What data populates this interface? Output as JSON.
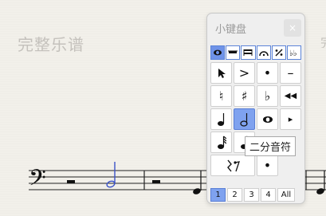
{
  "score": {
    "title": "完整乐谱",
    "title_cut_right": "完"
  },
  "palette": {
    "title": "小键盘",
    "close_label": "×",
    "tabs": [
      {
        "name": "tab-notes",
        "icon": "whole-note-icon",
        "active": true
      },
      {
        "name": "tab-rests",
        "icon": "rest-icon",
        "active": false
      },
      {
        "name": "tab-beams",
        "icon": "beam-icon",
        "active": false
      },
      {
        "name": "tab-articulations",
        "icon": "fermata-icon",
        "active": false
      },
      {
        "name": "tab-tuplets",
        "icon": "tuplet-icon",
        "active": false
      },
      {
        "name": "tab-accidentals",
        "icon": "double-flat-icon",
        "active": false
      }
    ],
    "rows": [
      [
        {
          "label": "",
          "icon": "pointer-icon"
        },
        {
          "label": ">",
          "icon": "accent-icon"
        },
        {
          "label": "•",
          "icon": "staccato-icon"
        },
        {
          "label": "–",
          "icon": "tenuto-icon"
        }
      ],
      [
        {
          "label": "♮",
          "icon": "natural-icon"
        },
        {
          "label": "♯",
          "icon": "sharp-icon"
        },
        {
          "label": "♭",
          "icon": "flat-icon"
        },
        {
          "label": "◀◀",
          "icon": "rewind-icon"
        }
      ],
      [
        {
          "label": "♩",
          "icon": "quarter-note-icon"
        },
        {
          "label": "𝅗𝅥",
          "icon": "half-note-icon",
          "active": true
        },
        {
          "label": "𝅝",
          "icon": "whole-note-icon"
        },
        {
          "label": "▸",
          "icon": "play-icon"
        }
      ],
      [
        {
          "label": "𝅘𝅥𝅯",
          "icon": "sixteenth-note-icon"
        },
        {
          "label": "𝅘𝅥𝅮",
          "icon": "eighth-note-icon"
        },
        {
          "label": "",
          "icon": "hidden-cell"
        },
        {
          "label": "",
          "icon": "hidden-cell"
        }
      ],
      [
        {
          "label": "𝄽𝄾",
          "icon": "rest-icon",
          "wide": true
        },
        {
          "label": "•",
          "icon": "dot-icon"
        }
      ]
    ],
    "voices": [
      "1",
      "2",
      "3",
      "4",
      "All"
    ],
    "active_voice": "1",
    "tooltip": "二分音符"
  }
}
